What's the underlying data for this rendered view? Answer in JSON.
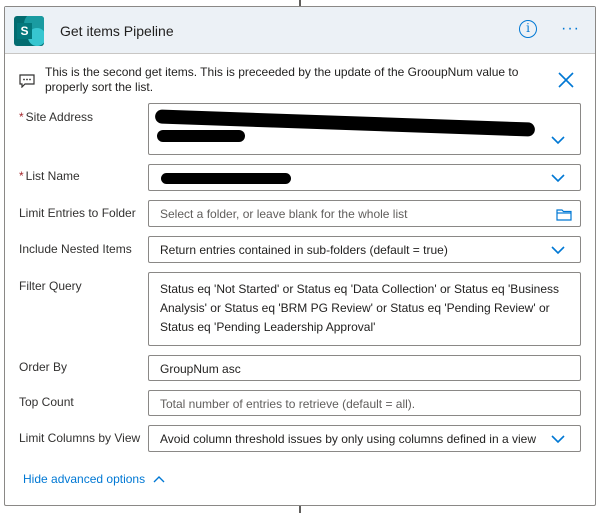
{
  "card": {
    "title": "Get items Pipeline",
    "info_glyph": "i",
    "more_glyph": "···",
    "comment": "This is the second get items. This is preceeded by the update of the GrooupNum value to properly sort the list."
  },
  "fields": {
    "site_address": {
      "label": "Site Address",
      "required": "*",
      "value": ""
    },
    "list_name": {
      "label": "List Name",
      "required": "*",
      "value": ""
    },
    "limit_folder": {
      "label": "Limit Entries to Folder",
      "placeholder": "Select a folder, or leave blank for the whole list"
    },
    "nested": {
      "label": "Include Nested Items",
      "value": "Return entries contained in sub-folders (default = true)"
    },
    "filter": {
      "label": "Filter Query",
      "value": "Status eq 'Not Started' or Status eq 'Data Collection' or Status eq 'Business Analysis' or Status eq 'BRM PG Review' or Status eq 'Pending Review' or Status eq 'Pending Leadership Approval'"
    },
    "order_by": {
      "label": "Order By",
      "value": "GroupNum asc"
    },
    "top_count": {
      "label": "Top Count",
      "placeholder": "Total number of entries to retrieve (default = all)."
    },
    "limit_columns": {
      "label": "Limit Columns by View",
      "value": "Avoid column threshold issues by only using columns defined in a view"
    }
  },
  "advanced_link": "Hide advanced options",
  "icons": {
    "logo": "sharepoint-logo-icon",
    "info": "info-icon",
    "more": "more-options-icon",
    "comment": "comment-icon",
    "close": "close-icon",
    "dropdown": "chevron-down-icon",
    "folder": "folder-icon",
    "collapse": "chevron-up-icon"
  },
  "colors": {
    "accent": "#0078d4",
    "header_bg": "#ecf1f6",
    "required": "#a4262c",
    "logo": "#036c70"
  }
}
